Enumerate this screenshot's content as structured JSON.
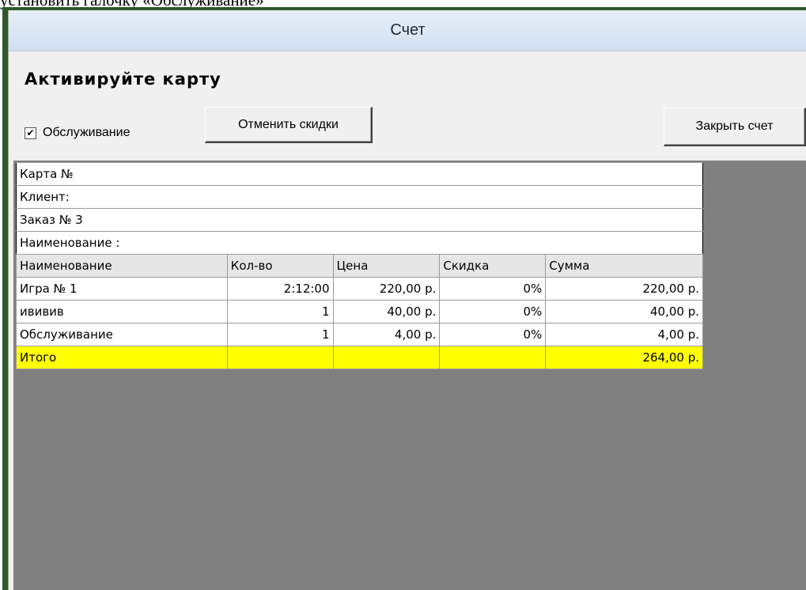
{
  "caption": "установить галочку «Обслуживание»",
  "window": {
    "title": "Счет"
  },
  "heading": "Активируйте карту",
  "service_checkbox": {
    "label": "Обслуживание",
    "checked": true
  },
  "buttons": {
    "cancel_discounts": "Отменить скидки",
    "close_bill": "Закрыть счет"
  },
  "info": {
    "card": "Карта №",
    "client": "Клиент:",
    "order": "Заказ №  3",
    "name": "Наименование :"
  },
  "table": {
    "columns": [
      "Наименование",
      "Кол-во",
      "Цена",
      "Скидка",
      "Сумма"
    ],
    "rows": [
      [
        "Игра № 1",
        "2:12:00",
        "220,00 р.",
        "0%",
        "220,00 р."
      ],
      [
        "ививив",
        "1",
        "40,00 р.",
        "0%",
        "40,00 р."
      ],
      [
        "Обслуживание",
        "1",
        "4,00 р.",
        "0%",
        "4,00 р."
      ]
    ],
    "total": {
      "label": "Итого",
      "sum": "264,00 р."
    }
  },
  "colors": {
    "total_highlight": "#ffff00",
    "workspace": "#808080"
  }
}
